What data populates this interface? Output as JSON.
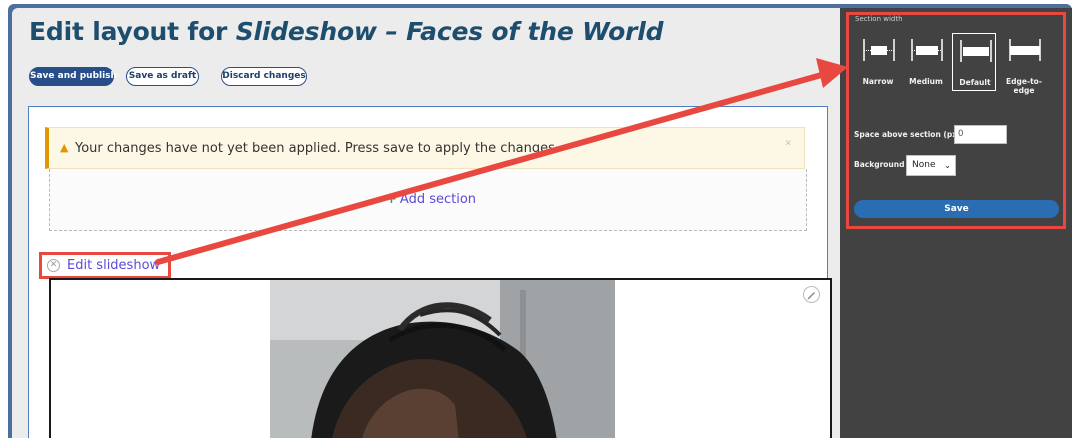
{
  "page": {
    "title_prefix": "Edit layout for ",
    "title_name": "Slideshow – Faces of the World"
  },
  "actions": {
    "save_publish": "Save and publish",
    "save_draft": "Save as draft",
    "discard": "Discard changes"
  },
  "warning": {
    "icon": "warning-triangle-icon",
    "text": "Your changes have not yet been applied. Press save to apply the changes."
  },
  "add_section": {
    "label": "Add section"
  },
  "block": {
    "edit_label": "Edit slideshow"
  },
  "sidebar": {
    "section_width_label": "Section width",
    "width_options": [
      {
        "label": "Narrow",
        "selected": false
      },
      {
        "label": "Medium",
        "selected": false
      },
      {
        "label": "Default",
        "selected": true
      },
      {
        "label": "Edge-to-edge",
        "selected": false
      }
    ],
    "space_above_label": "Space above section (px)",
    "space_above_placeholder": "0",
    "background_label": "Background",
    "background_value": "None",
    "save_label": "Save"
  },
  "colors": {
    "highlight": "#e8483f",
    "title": "#1e4e6e",
    "link": "#5b4bd8",
    "sidebar": "#424242",
    "save_button": "#2a6db2"
  }
}
